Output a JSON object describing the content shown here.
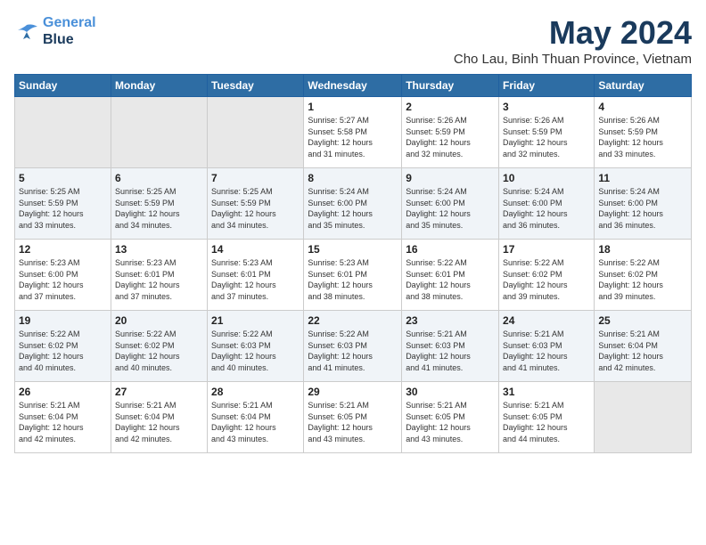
{
  "logo": {
    "line1": "General",
    "line2": "Blue"
  },
  "title": "May 2024",
  "location": "Cho Lau, Binh Thuan Province, Vietnam",
  "days_header": [
    "Sunday",
    "Monday",
    "Tuesday",
    "Wednesday",
    "Thursday",
    "Friday",
    "Saturday"
  ],
  "weeks": [
    [
      {
        "day": "",
        "info": ""
      },
      {
        "day": "",
        "info": ""
      },
      {
        "day": "",
        "info": ""
      },
      {
        "day": "1",
        "info": "Sunrise: 5:27 AM\nSunset: 5:58 PM\nDaylight: 12 hours\nand 31 minutes."
      },
      {
        "day": "2",
        "info": "Sunrise: 5:26 AM\nSunset: 5:59 PM\nDaylight: 12 hours\nand 32 minutes."
      },
      {
        "day": "3",
        "info": "Sunrise: 5:26 AM\nSunset: 5:59 PM\nDaylight: 12 hours\nand 32 minutes."
      },
      {
        "day": "4",
        "info": "Sunrise: 5:26 AM\nSunset: 5:59 PM\nDaylight: 12 hours\nand 33 minutes."
      }
    ],
    [
      {
        "day": "5",
        "info": "Sunrise: 5:25 AM\nSunset: 5:59 PM\nDaylight: 12 hours\nand 33 minutes."
      },
      {
        "day": "6",
        "info": "Sunrise: 5:25 AM\nSunset: 5:59 PM\nDaylight: 12 hours\nand 34 minutes."
      },
      {
        "day": "7",
        "info": "Sunrise: 5:25 AM\nSunset: 5:59 PM\nDaylight: 12 hours\nand 34 minutes."
      },
      {
        "day": "8",
        "info": "Sunrise: 5:24 AM\nSunset: 6:00 PM\nDaylight: 12 hours\nand 35 minutes."
      },
      {
        "day": "9",
        "info": "Sunrise: 5:24 AM\nSunset: 6:00 PM\nDaylight: 12 hours\nand 35 minutes."
      },
      {
        "day": "10",
        "info": "Sunrise: 5:24 AM\nSunset: 6:00 PM\nDaylight: 12 hours\nand 36 minutes."
      },
      {
        "day": "11",
        "info": "Sunrise: 5:24 AM\nSunset: 6:00 PM\nDaylight: 12 hours\nand 36 minutes."
      }
    ],
    [
      {
        "day": "12",
        "info": "Sunrise: 5:23 AM\nSunset: 6:00 PM\nDaylight: 12 hours\nand 37 minutes."
      },
      {
        "day": "13",
        "info": "Sunrise: 5:23 AM\nSunset: 6:01 PM\nDaylight: 12 hours\nand 37 minutes."
      },
      {
        "day": "14",
        "info": "Sunrise: 5:23 AM\nSunset: 6:01 PM\nDaylight: 12 hours\nand 37 minutes."
      },
      {
        "day": "15",
        "info": "Sunrise: 5:23 AM\nSunset: 6:01 PM\nDaylight: 12 hours\nand 38 minutes."
      },
      {
        "day": "16",
        "info": "Sunrise: 5:22 AM\nSunset: 6:01 PM\nDaylight: 12 hours\nand 38 minutes."
      },
      {
        "day": "17",
        "info": "Sunrise: 5:22 AM\nSunset: 6:02 PM\nDaylight: 12 hours\nand 39 minutes."
      },
      {
        "day": "18",
        "info": "Sunrise: 5:22 AM\nSunset: 6:02 PM\nDaylight: 12 hours\nand 39 minutes."
      }
    ],
    [
      {
        "day": "19",
        "info": "Sunrise: 5:22 AM\nSunset: 6:02 PM\nDaylight: 12 hours\nand 40 minutes."
      },
      {
        "day": "20",
        "info": "Sunrise: 5:22 AM\nSunset: 6:02 PM\nDaylight: 12 hours\nand 40 minutes."
      },
      {
        "day": "21",
        "info": "Sunrise: 5:22 AM\nSunset: 6:03 PM\nDaylight: 12 hours\nand 40 minutes."
      },
      {
        "day": "22",
        "info": "Sunrise: 5:22 AM\nSunset: 6:03 PM\nDaylight: 12 hours\nand 41 minutes."
      },
      {
        "day": "23",
        "info": "Sunrise: 5:21 AM\nSunset: 6:03 PM\nDaylight: 12 hours\nand 41 minutes."
      },
      {
        "day": "24",
        "info": "Sunrise: 5:21 AM\nSunset: 6:03 PM\nDaylight: 12 hours\nand 41 minutes."
      },
      {
        "day": "25",
        "info": "Sunrise: 5:21 AM\nSunset: 6:04 PM\nDaylight: 12 hours\nand 42 minutes."
      }
    ],
    [
      {
        "day": "26",
        "info": "Sunrise: 5:21 AM\nSunset: 6:04 PM\nDaylight: 12 hours\nand 42 minutes."
      },
      {
        "day": "27",
        "info": "Sunrise: 5:21 AM\nSunset: 6:04 PM\nDaylight: 12 hours\nand 42 minutes."
      },
      {
        "day": "28",
        "info": "Sunrise: 5:21 AM\nSunset: 6:04 PM\nDaylight: 12 hours\nand 43 minutes."
      },
      {
        "day": "29",
        "info": "Sunrise: 5:21 AM\nSunset: 6:05 PM\nDaylight: 12 hours\nand 43 minutes."
      },
      {
        "day": "30",
        "info": "Sunrise: 5:21 AM\nSunset: 6:05 PM\nDaylight: 12 hours\nand 43 minutes."
      },
      {
        "day": "31",
        "info": "Sunrise: 5:21 AM\nSunset: 6:05 PM\nDaylight: 12 hours\nand 44 minutes."
      },
      {
        "day": "",
        "info": ""
      }
    ]
  ]
}
